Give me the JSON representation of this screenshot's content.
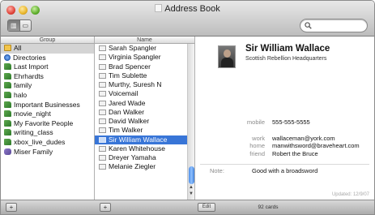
{
  "window": {
    "title": "Address Book"
  },
  "columns": {
    "group": "Group",
    "name": "Name"
  },
  "groups": [
    {
      "label": "All",
      "icon": "all",
      "selected": true
    },
    {
      "label": "Directories",
      "icon": "dir"
    },
    {
      "label": "Last Import",
      "icon": "grp"
    },
    {
      "label": "Ehrhardts",
      "icon": "grp"
    },
    {
      "label": "family",
      "icon": "grp"
    },
    {
      "label": "halo",
      "icon": "grp"
    },
    {
      "label": "Important Businesses",
      "icon": "grp"
    },
    {
      "label": "movie_night",
      "icon": "grp"
    },
    {
      "label": "My Favorite People",
      "icon": "grp"
    },
    {
      "label": "writing_class",
      "icon": "grp"
    },
    {
      "label": "xbox_live_dudes",
      "icon": "grp"
    },
    {
      "label": "Miser Family",
      "icon": "smart"
    }
  ],
  "names": [
    {
      "label": "Sarah Spangler"
    },
    {
      "label": "Virginia Spangler"
    },
    {
      "label": "Brad Spencer"
    },
    {
      "label": "Tim Sublette"
    },
    {
      "label": "Murthy, Suresh N"
    },
    {
      "label": "Voicemail"
    },
    {
      "label": "Jared Wade"
    },
    {
      "label": "Dan Walker"
    },
    {
      "label": "David Walker"
    },
    {
      "label": "Tim Walker"
    },
    {
      "label": "Sir William Wallace",
      "selected": true
    },
    {
      "label": "Karen Whitehouse"
    },
    {
      "label": "Dreyer Yamaha"
    },
    {
      "label": "Melanie Ziegler"
    }
  ],
  "card": {
    "name": "Sir William Wallace",
    "organization": "Scottish Rebellion Headquarters",
    "fields": [
      {
        "label": "mobile",
        "value": "555-555-5555"
      },
      {
        "label": "work",
        "value": "wallaceman@york.com"
      },
      {
        "label": "home",
        "value": "manwithsword@braveheart.com"
      },
      {
        "label": "friend",
        "value": "Robert the Bruce"
      }
    ],
    "note_label": "Note:",
    "note": "Good with a broadsword",
    "updated": "Updated: 12/9/07"
  },
  "footer": {
    "add": "+",
    "edit": "Edit",
    "count": "92 cards"
  }
}
